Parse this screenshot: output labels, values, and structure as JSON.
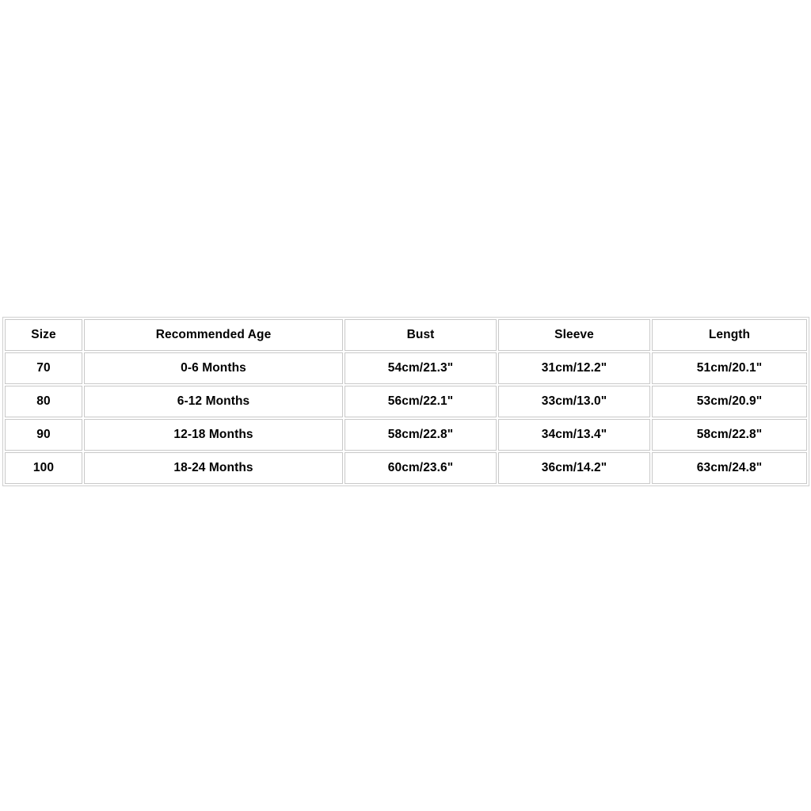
{
  "page": {
    "background_color": "#ffffff",
    "text_color": "#000000",
    "border_color": "#c9c9c9"
  },
  "size_chart": {
    "columns": [
      "Size",
      "Recommended Age",
      "Bust",
      "Sleeve",
      "Length"
    ],
    "rows": [
      {
        "size": "70",
        "age": "0-6 Months",
        "bust": "54cm/21.3\"",
        "sleeve": "31cm/12.2\"",
        "length": "51cm/20.1\""
      },
      {
        "size": "80",
        "age": "6-12 Months",
        "bust": "56cm/22.1\"",
        "sleeve": "33cm/13.0\"",
        "length": "53cm/20.9\""
      },
      {
        "size": "90",
        "age": "12-18 Months",
        "bust": "58cm/22.8\"",
        "sleeve": "34cm/13.4\"",
        "length": "58cm/22.8\""
      },
      {
        "size": "100",
        "age": "18-24 Months",
        "bust": "60cm/23.6\"",
        "sleeve": "36cm/14.2\"",
        "length": "63cm/24.8\""
      }
    ]
  }
}
